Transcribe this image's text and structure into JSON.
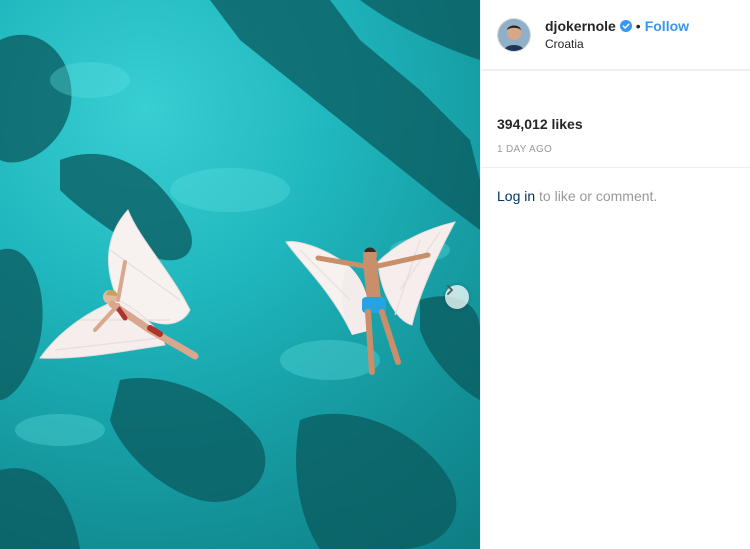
{
  "header": {
    "username": "djokernole",
    "separator": "•",
    "follow_label": "Follow",
    "location": "Croatia"
  },
  "stats": {
    "likes": "394,012 likes",
    "timestamp": "1 DAY AGO"
  },
  "comment_prompt": {
    "login_link": "Log in",
    "rest": "to like or comment."
  },
  "icons": {
    "verified": "verified-badge-icon",
    "next": "chevron-right-icon"
  },
  "colors": {
    "link_blue": "#3897f0",
    "verified_blue": "#3897f0",
    "water": "#1fb6bd"
  }
}
